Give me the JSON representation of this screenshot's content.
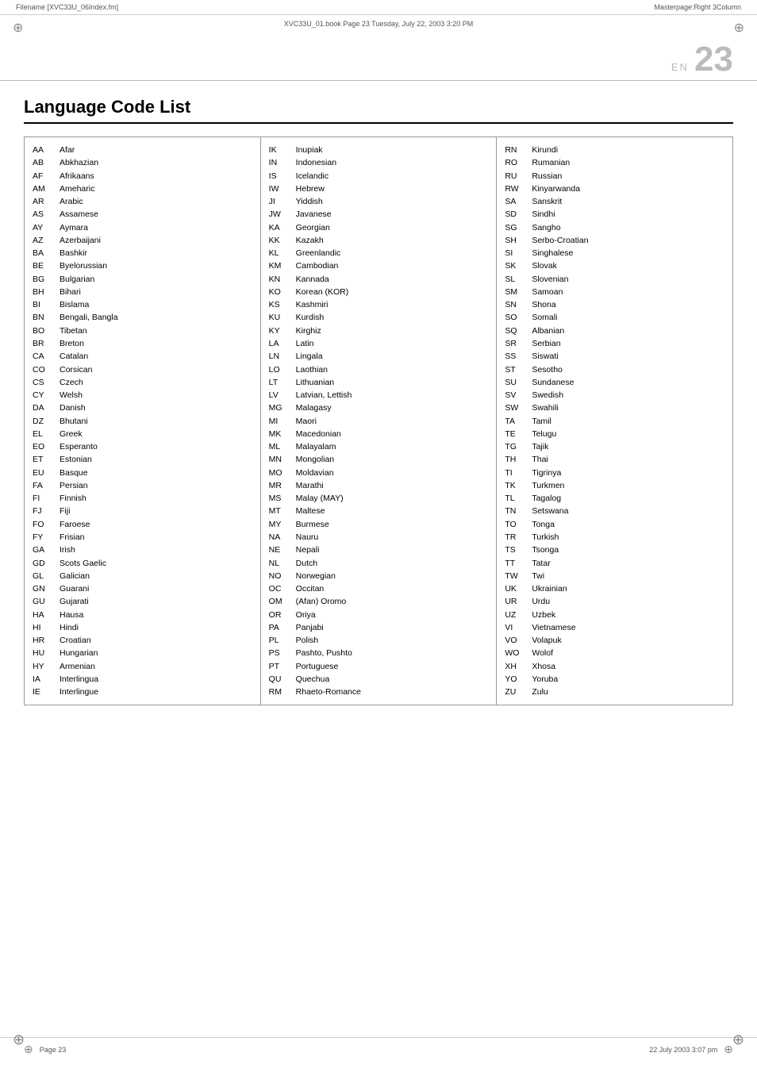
{
  "topbar": {
    "filename": "Filename [XVC33U_06Index.fm]",
    "bookinfo": "XVC33U_01.book  Page 23  Tuesday, July 22, 2003  3:20 PM",
    "masterpage": "Masterpage:Right 3Column"
  },
  "header": {
    "en_label": "EN",
    "page_number": "23"
  },
  "title": "Language Code List",
  "footer": {
    "page": "Page 23",
    "date": "22 July 2003  3:07 pm"
  },
  "col1": [
    {
      "code": "AA",
      "name": "Afar"
    },
    {
      "code": "AB",
      "name": "Abkhazian"
    },
    {
      "code": "AF",
      "name": "Afrikaans"
    },
    {
      "code": "AM",
      "name": "Ameharic"
    },
    {
      "code": "AR",
      "name": "Arabic"
    },
    {
      "code": "AS",
      "name": "Assamese"
    },
    {
      "code": "AY",
      "name": "Aymara"
    },
    {
      "code": "AZ",
      "name": "Azerbaijani"
    },
    {
      "code": "BA",
      "name": "Bashkir"
    },
    {
      "code": "BE",
      "name": "Byelorussian"
    },
    {
      "code": "BG",
      "name": "Bulgarian"
    },
    {
      "code": "BH",
      "name": "Bihari"
    },
    {
      "code": "BI",
      "name": "Bislama"
    },
    {
      "code": "BN",
      "name": "Bengali, Bangla"
    },
    {
      "code": "BO",
      "name": "Tibetan"
    },
    {
      "code": "BR",
      "name": "Breton"
    },
    {
      "code": "CA",
      "name": "Catalan"
    },
    {
      "code": "CO",
      "name": "Corsican"
    },
    {
      "code": "CS",
      "name": "Czech"
    },
    {
      "code": "CY",
      "name": "Welsh"
    },
    {
      "code": "DA",
      "name": "Danish"
    },
    {
      "code": "DZ",
      "name": "Bhutani"
    },
    {
      "code": "EL",
      "name": "Greek"
    },
    {
      "code": "EO",
      "name": "Esperanto"
    },
    {
      "code": "ET",
      "name": "Estonian"
    },
    {
      "code": "EU",
      "name": "Basque"
    },
    {
      "code": "FA",
      "name": "Persian"
    },
    {
      "code": "FI",
      "name": "Finnish"
    },
    {
      "code": "FJ",
      "name": "Fiji"
    },
    {
      "code": "FO",
      "name": "Faroese"
    },
    {
      "code": "FY",
      "name": "Frisian"
    },
    {
      "code": "GA",
      "name": "Irish"
    },
    {
      "code": "GD",
      "name": "Scots Gaelic"
    },
    {
      "code": "GL",
      "name": "Galician"
    },
    {
      "code": "GN",
      "name": "Guarani"
    },
    {
      "code": "GU",
      "name": "Gujarati"
    },
    {
      "code": "HA",
      "name": "Hausa"
    },
    {
      "code": "HI",
      "name": "Hindi"
    },
    {
      "code": "HR",
      "name": "Croatian"
    },
    {
      "code": "HU",
      "name": "Hungarian"
    },
    {
      "code": "HY",
      "name": "Armenian"
    },
    {
      "code": "IA",
      "name": "Interlingua"
    },
    {
      "code": "IE",
      "name": "Interlingue"
    }
  ],
  "col2": [
    {
      "code": "IK",
      "name": "Inupiak"
    },
    {
      "code": "IN",
      "name": "Indonesian"
    },
    {
      "code": "IS",
      "name": "Icelandic"
    },
    {
      "code": "IW",
      "name": "Hebrew"
    },
    {
      "code": "JI",
      "name": "Yiddish"
    },
    {
      "code": "JW",
      "name": "Javanese"
    },
    {
      "code": "KA",
      "name": "Georgian"
    },
    {
      "code": "KK",
      "name": "Kazakh"
    },
    {
      "code": "KL",
      "name": "Greenlandic"
    },
    {
      "code": "KM",
      "name": "Cambodian"
    },
    {
      "code": "KN",
      "name": "Kannada"
    },
    {
      "code": "KO",
      "name": "Korean (KOR)"
    },
    {
      "code": "KS",
      "name": "Kashmiri"
    },
    {
      "code": "KU",
      "name": "Kurdish"
    },
    {
      "code": "KY",
      "name": "Kirghiz"
    },
    {
      "code": "LA",
      "name": "Latin"
    },
    {
      "code": "LN",
      "name": "Lingala"
    },
    {
      "code": "LO",
      "name": "Laothian"
    },
    {
      "code": "LT",
      "name": "Lithuanian"
    },
    {
      "code": "LV",
      "name": "Latvian, Lettish"
    },
    {
      "code": "MG",
      "name": "Malagasy"
    },
    {
      "code": "MI",
      "name": "Maori"
    },
    {
      "code": "MK",
      "name": "Macedonian"
    },
    {
      "code": "ML",
      "name": "Malayalam"
    },
    {
      "code": "MN",
      "name": "Mongolian"
    },
    {
      "code": "MO",
      "name": "Moldavian"
    },
    {
      "code": "MR",
      "name": "Marathi"
    },
    {
      "code": "MS",
      "name": "Malay (MAY)"
    },
    {
      "code": "MT",
      "name": "Maltese"
    },
    {
      "code": "MY",
      "name": "Burmese"
    },
    {
      "code": "NA",
      "name": "Nauru"
    },
    {
      "code": "NE",
      "name": "Nepali"
    },
    {
      "code": "NL",
      "name": "Dutch"
    },
    {
      "code": "NO",
      "name": "Norwegian"
    },
    {
      "code": "OC",
      "name": "Occitan"
    },
    {
      "code": "OM",
      "name": "(Afan) Oromo"
    },
    {
      "code": "OR",
      "name": "Oriya"
    },
    {
      "code": "PA",
      "name": "Panjabi"
    },
    {
      "code": "PL",
      "name": "Polish"
    },
    {
      "code": "PS",
      "name": "Pashto, Pushto"
    },
    {
      "code": "PT",
      "name": "Portuguese"
    },
    {
      "code": "QU",
      "name": "Quechua"
    },
    {
      "code": "RM",
      "name": "Rhaeto-Romance"
    }
  ],
  "col3": [
    {
      "code": "RN",
      "name": "Kirundi"
    },
    {
      "code": "RO",
      "name": "Rumanian"
    },
    {
      "code": "RU",
      "name": "Russian"
    },
    {
      "code": "RW",
      "name": "Kinyarwanda"
    },
    {
      "code": "SA",
      "name": "Sanskrit"
    },
    {
      "code": "SD",
      "name": "Sindhi"
    },
    {
      "code": "SG",
      "name": "Sangho"
    },
    {
      "code": "SH",
      "name": "Serbo-Croatian"
    },
    {
      "code": "SI",
      "name": "Singhalese"
    },
    {
      "code": "SK",
      "name": "Slovak"
    },
    {
      "code": "SL",
      "name": "Slovenian"
    },
    {
      "code": "SM",
      "name": "Samoan"
    },
    {
      "code": "SN",
      "name": "Shona"
    },
    {
      "code": "SO",
      "name": "Somali"
    },
    {
      "code": "SQ",
      "name": "Albanian"
    },
    {
      "code": "SR",
      "name": "Serbian"
    },
    {
      "code": "SS",
      "name": "Siswati"
    },
    {
      "code": "ST",
      "name": "Sesotho"
    },
    {
      "code": "SU",
      "name": "Sundanese"
    },
    {
      "code": "SV",
      "name": "Swedish"
    },
    {
      "code": "SW",
      "name": "Swahili"
    },
    {
      "code": "TA",
      "name": "Tamil"
    },
    {
      "code": "TE",
      "name": "Telugu"
    },
    {
      "code": "TG",
      "name": "Tajik"
    },
    {
      "code": "TH",
      "name": "Thai"
    },
    {
      "code": "TI",
      "name": "Tigrinya"
    },
    {
      "code": "TK",
      "name": "Turkmen"
    },
    {
      "code": "TL",
      "name": "Tagalog"
    },
    {
      "code": "TN",
      "name": "Setswana"
    },
    {
      "code": "TO",
      "name": "Tonga"
    },
    {
      "code": "TR",
      "name": "Turkish"
    },
    {
      "code": "TS",
      "name": "Tsonga"
    },
    {
      "code": "TT",
      "name": "Tatar"
    },
    {
      "code": "TW",
      "name": "Twi"
    },
    {
      "code": "UK",
      "name": "Ukrainian"
    },
    {
      "code": "UR",
      "name": "Urdu"
    },
    {
      "code": "UZ",
      "name": "Uzbek"
    },
    {
      "code": "VI",
      "name": "Vietnamese"
    },
    {
      "code": "VO",
      "name": "Volapuk"
    },
    {
      "code": "WO",
      "name": "Wolof"
    },
    {
      "code": "XH",
      "name": "Xhosa"
    },
    {
      "code": "YO",
      "name": "Yoruba"
    },
    {
      "code": "ZU",
      "name": "Zulu"
    }
  ]
}
